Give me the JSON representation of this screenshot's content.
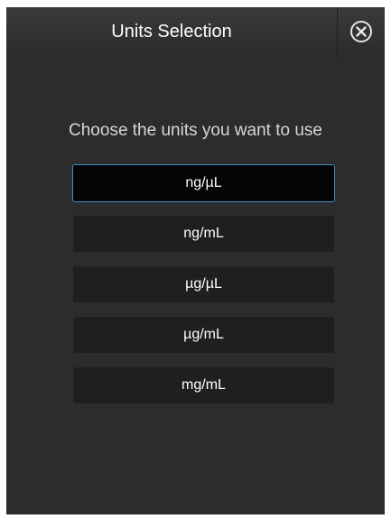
{
  "dialog": {
    "title": "Units Selection",
    "close_icon": "close-circle-icon",
    "prompt": "Choose the units you want to use",
    "options": [
      {
        "label": "ng/µL",
        "selected": true
      },
      {
        "label": "ng/mL",
        "selected": false
      },
      {
        "label": "µg/µL",
        "selected": false
      },
      {
        "label": "µg/mL",
        "selected": false
      },
      {
        "label": "mg/mL",
        "selected": false
      }
    ]
  },
  "colors": {
    "background": "#2c2c2c",
    "selected_border": "#3f8dc0"
  }
}
